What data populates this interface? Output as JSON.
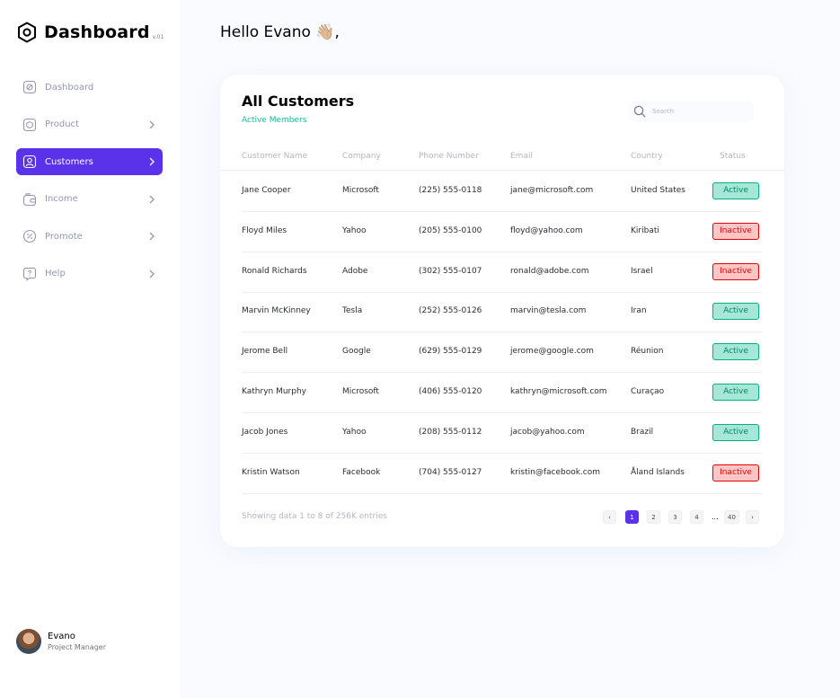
{
  "brand": {
    "title": "Dashboard",
    "version": "v.01"
  },
  "nav": [
    {
      "label": "Dashboard",
      "icon": "dashboard-icon",
      "chevron": false,
      "active": false
    },
    {
      "label": "Product",
      "icon": "product-icon",
      "chevron": true,
      "active": false
    },
    {
      "label": "Customers",
      "icon": "customers-icon",
      "chevron": true,
      "active": true
    },
    {
      "label": "Income",
      "icon": "income-icon",
      "chevron": true,
      "active": false
    },
    {
      "label": "Promote",
      "icon": "promote-icon",
      "chevron": true,
      "active": false
    },
    {
      "label": "Help",
      "icon": "help-icon",
      "chevron": true,
      "active": false
    }
  ],
  "profile": {
    "name": "Evano",
    "role": "Project Manager"
  },
  "greeting": "Hello Evano 👋🏼,",
  "card": {
    "title": "All Customers",
    "subtitle": "Active Members",
    "search_placeholder": "Search"
  },
  "table": {
    "columns": [
      "Customer Name",
      "Company",
      "Phone Number",
      "Email",
      "Country",
      "Status"
    ],
    "rows": [
      {
        "name": "Jane Cooper",
        "company": "Microsoft",
        "phone": "(225) 555-0118",
        "email": "jane@microsoft.com",
        "country": "United States",
        "status": "Active"
      },
      {
        "name": "Floyd Miles",
        "company": "Yahoo",
        "phone": "(205) 555-0100",
        "email": "floyd@yahoo.com",
        "country": "Kiribati",
        "status": "Inactive"
      },
      {
        "name": "Ronald Richards",
        "company": "Adobe",
        "phone": "(302) 555-0107",
        "email": "ronald@adobe.com",
        "country": "Israel",
        "status": "Inactive"
      },
      {
        "name": "Marvin McKinney",
        "company": "Tesla",
        "phone": "(252) 555-0126",
        "email": "marvin@tesla.com",
        "country": "Iran",
        "status": "Active"
      },
      {
        "name": "Jerome Bell",
        "company": "Google",
        "phone": "(629) 555-0129",
        "email": "jerome@google.com",
        "country": "Réunion",
        "status": "Active"
      },
      {
        "name": "Kathryn Murphy",
        "company": "Microsoft",
        "phone": "(406) 555-0120",
        "email": "kathryn@microsoft.com",
        "country": "Curaçao",
        "status": "Active"
      },
      {
        "name": "Jacob Jones",
        "company": "Yahoo",
        "phone": "(208) 555-0112",
        "email": "jacob@yahoo.com",
        "country": "Brazil",
        "status": "Active"
      },
      {
        "name": "Kristin Watson",
        "company": "Facebook",
        "phone": "(704) 555-0127",
        "email": "kristin@facebook.com",
        "country": "Åland Islands",
        "status": "Inactive"
      }
    ]
  },
  "footer": {
    "entries_text": "Showing data 1 to 8 of  256K entries"
  },
  "pagination": {
    "prev": "‹",
    "pages": [
      "1",
      "2",
      "3",
      "4"
    ],
    "ellipsis": "...",
    "last": "40",
    "next": "›",
    "current": "1"
  },
  "colors": {
    "accent": "#5932ea",
    "active_badge": "#00b087",
    "inactive_badge": "#df0404",
    "subtitle": "#16c098"
  }
}
